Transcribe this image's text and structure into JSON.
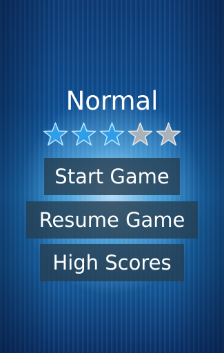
{
  "difficulty": {
    "label": "Normal",
    "rating": 3,
    "max_rating": 5
  },
  "menu": {
    "start_label": "Start Game",
    "resume_label": "Resume Game",
    "scores_label": "High Scores"
  },
  "colors": {
    "star_filled": "#2f9ee8",
    "star_empty": "#a9b2b8",
    "button_bg": "#263e52",
    "text": "#ffffff"
  },
  "icons": {
    "star": "star-icon"
  }
}
